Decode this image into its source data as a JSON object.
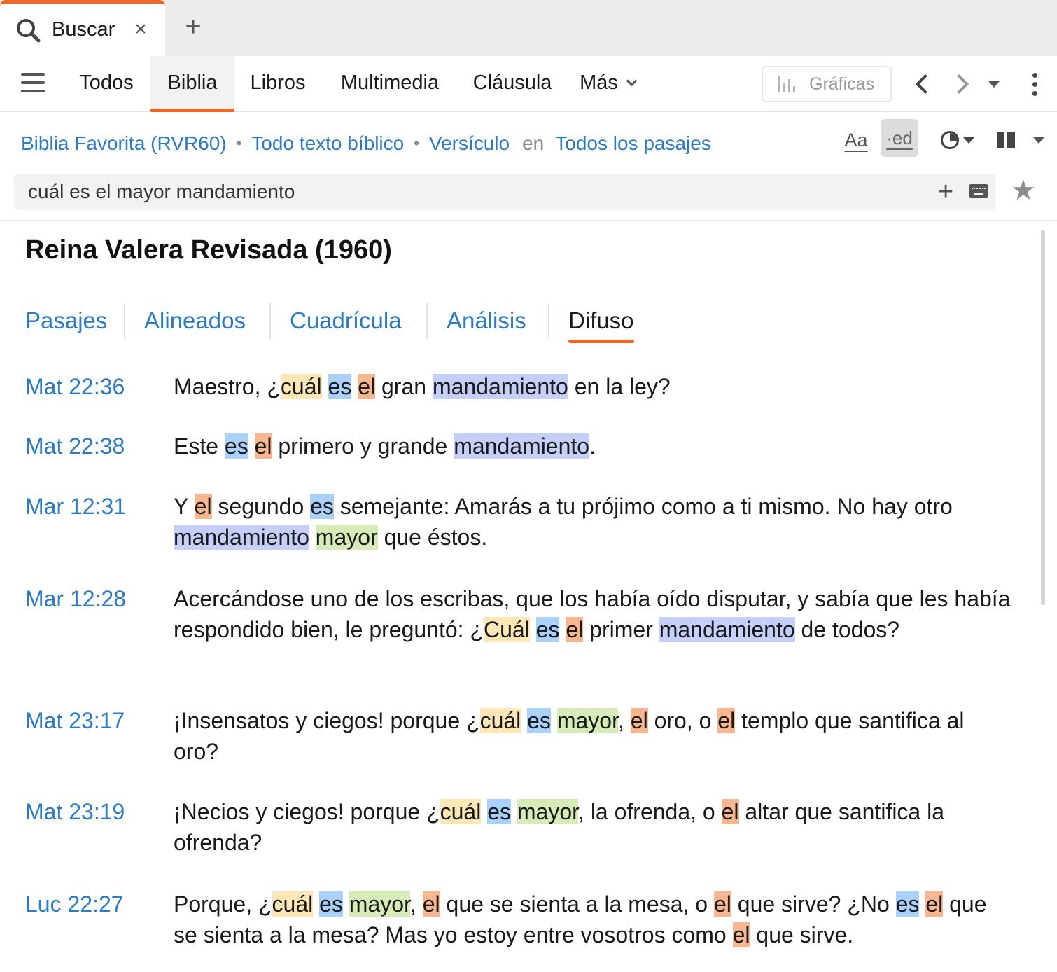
{
  "tab": {
    "label": "Buscar",
    "close": "×",
    "new_tab": "+"
  },
  "nav": {
    "tabs": [
      "Todos",
      "Biblia",
      "Libros",
      "Multimedia",
      "Cláusula",
      "Más"
    ],
    "active_tab": "Biblia",
    "graficas_label": "Gráficas"
  },
  "scope": {
    "bible": "Biblia Favorita (RVR60)",
    "range": "Todo texto bíblico",
    "unit": "Versículo",
    "in_word": "en",
    "passages": "Todos los pasajes",
    "dot": "•"
  },
  "tools": {
    "font_label": "Aa",
    "ed_label": "·ed"
  },
  "search": {
    "query": "cuál es el mayor mandamiento",
    "plus": "+",
    "star": "★"
  },
  "accent_color": "#f26522",
  "link_color": "#2b7bc4",
  "highlight_colors": {
    "cuál": "#fde7b7",
    "es": "#a9d1fb",
    "el": "#f9b68f",
    "mandamiento": "#c5cffa",
    "mayor": "#d6ebb7"
  },
  "main": {
    "title": "Reina Valera Revisada (1960)",
    "views": [
      "Pasajes",
      "Alineados",
      "Cuadrícula",
      "Análisis",
      "Difuso"
    ],
    "active_view": "Difuso",
    "results": [
      {
        "ref": "Mat 22:36",
        "verse": "Maestro, ¿cuál es el gran mandamiento en la ley?"
      },
      {
        "ref": "Mat 22:38",
        "verse": "Este es el primero y grande mandamiento."
      },
      {
        "ref": "Mar 12:31",
        "verse": "Y el segundo es semejante: Amarás a tu prójimo como a ti mismo. No hay otro mandamiento mayor que éstos."
      },
      {
        "ref": "Mar 12:28",
        "verse": "Acercándose uno de los escribas, que los había oído disputar, y sabía que les había respondido bien, le preguntó: ¿Cuál es el primer mandamiento de todos?"
      },
      {
        "ref": "Mat 23:17",
        "verse": "¡Insensatos y ciegos! porque ¿cuál es mayor, el oro, o el templo que santifica al oro?"
      },
      {
        "ref": "Mat 23:19",
        "verse": "¡Necios y ciegos! porque ¿cuál es mayor, la ofrenda, o el altar que santifica la ofrenda?"
      },
      {
        "ref": "Luc 22:27",
        "verse": "Porque, ¿cuál es mayor, el que se sienta a la mesa, o el que sirve? ¿No es el que se sienta a la mesa? Mas yo estoy entre vosotros como el que sirve."
      }
    ]
  }
}
